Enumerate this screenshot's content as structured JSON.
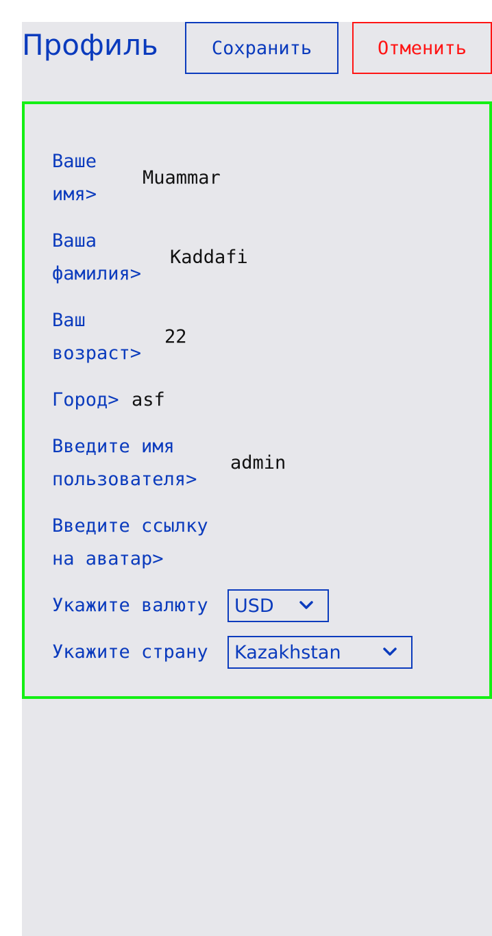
{
  "header": {
    "title": "Профиль",
    "save_label": "Сохранить",
    "cancel_label": "Отменить"
  },
  "form": {
    "name_label_1": "Ваше",
    "name_label_2": "имя>",
    "name_value": "Muammar",
    "surname_label_1": "Ваша",
    "surname_label_2": "фамилия>",
    "surname_value": "Kaddafi",
    "age_label_1": "Ваш",
    "age_label_2": "возраст>",
    "age_value": "22",
    "city_label": "Город>",
    "city_value": "asf",
    "username_label_1": "Введите имя",
    "username_label_2": "пользователя>",
    "username_value": "admin",
    "avatar_label_1": "Введите ссылку",
    "avatar_label_2": "на аватар>",
    "avatar_value": "",
    "currency_label": "Укажите валюту",
    "currency_value": "USD",
    "country_label": "Укажите страну",
    "country_value": "Kazakhstan"
  },
  "colors": {
    "accent": "#0b3bbd",
    "cancel": "#ff1414",
    "form_border": "#14f014",
    "panel_bg": "#e7e7eb"
  },
  "icons": {
    "select_chevron": "chevron-down-icon"
  }
}
